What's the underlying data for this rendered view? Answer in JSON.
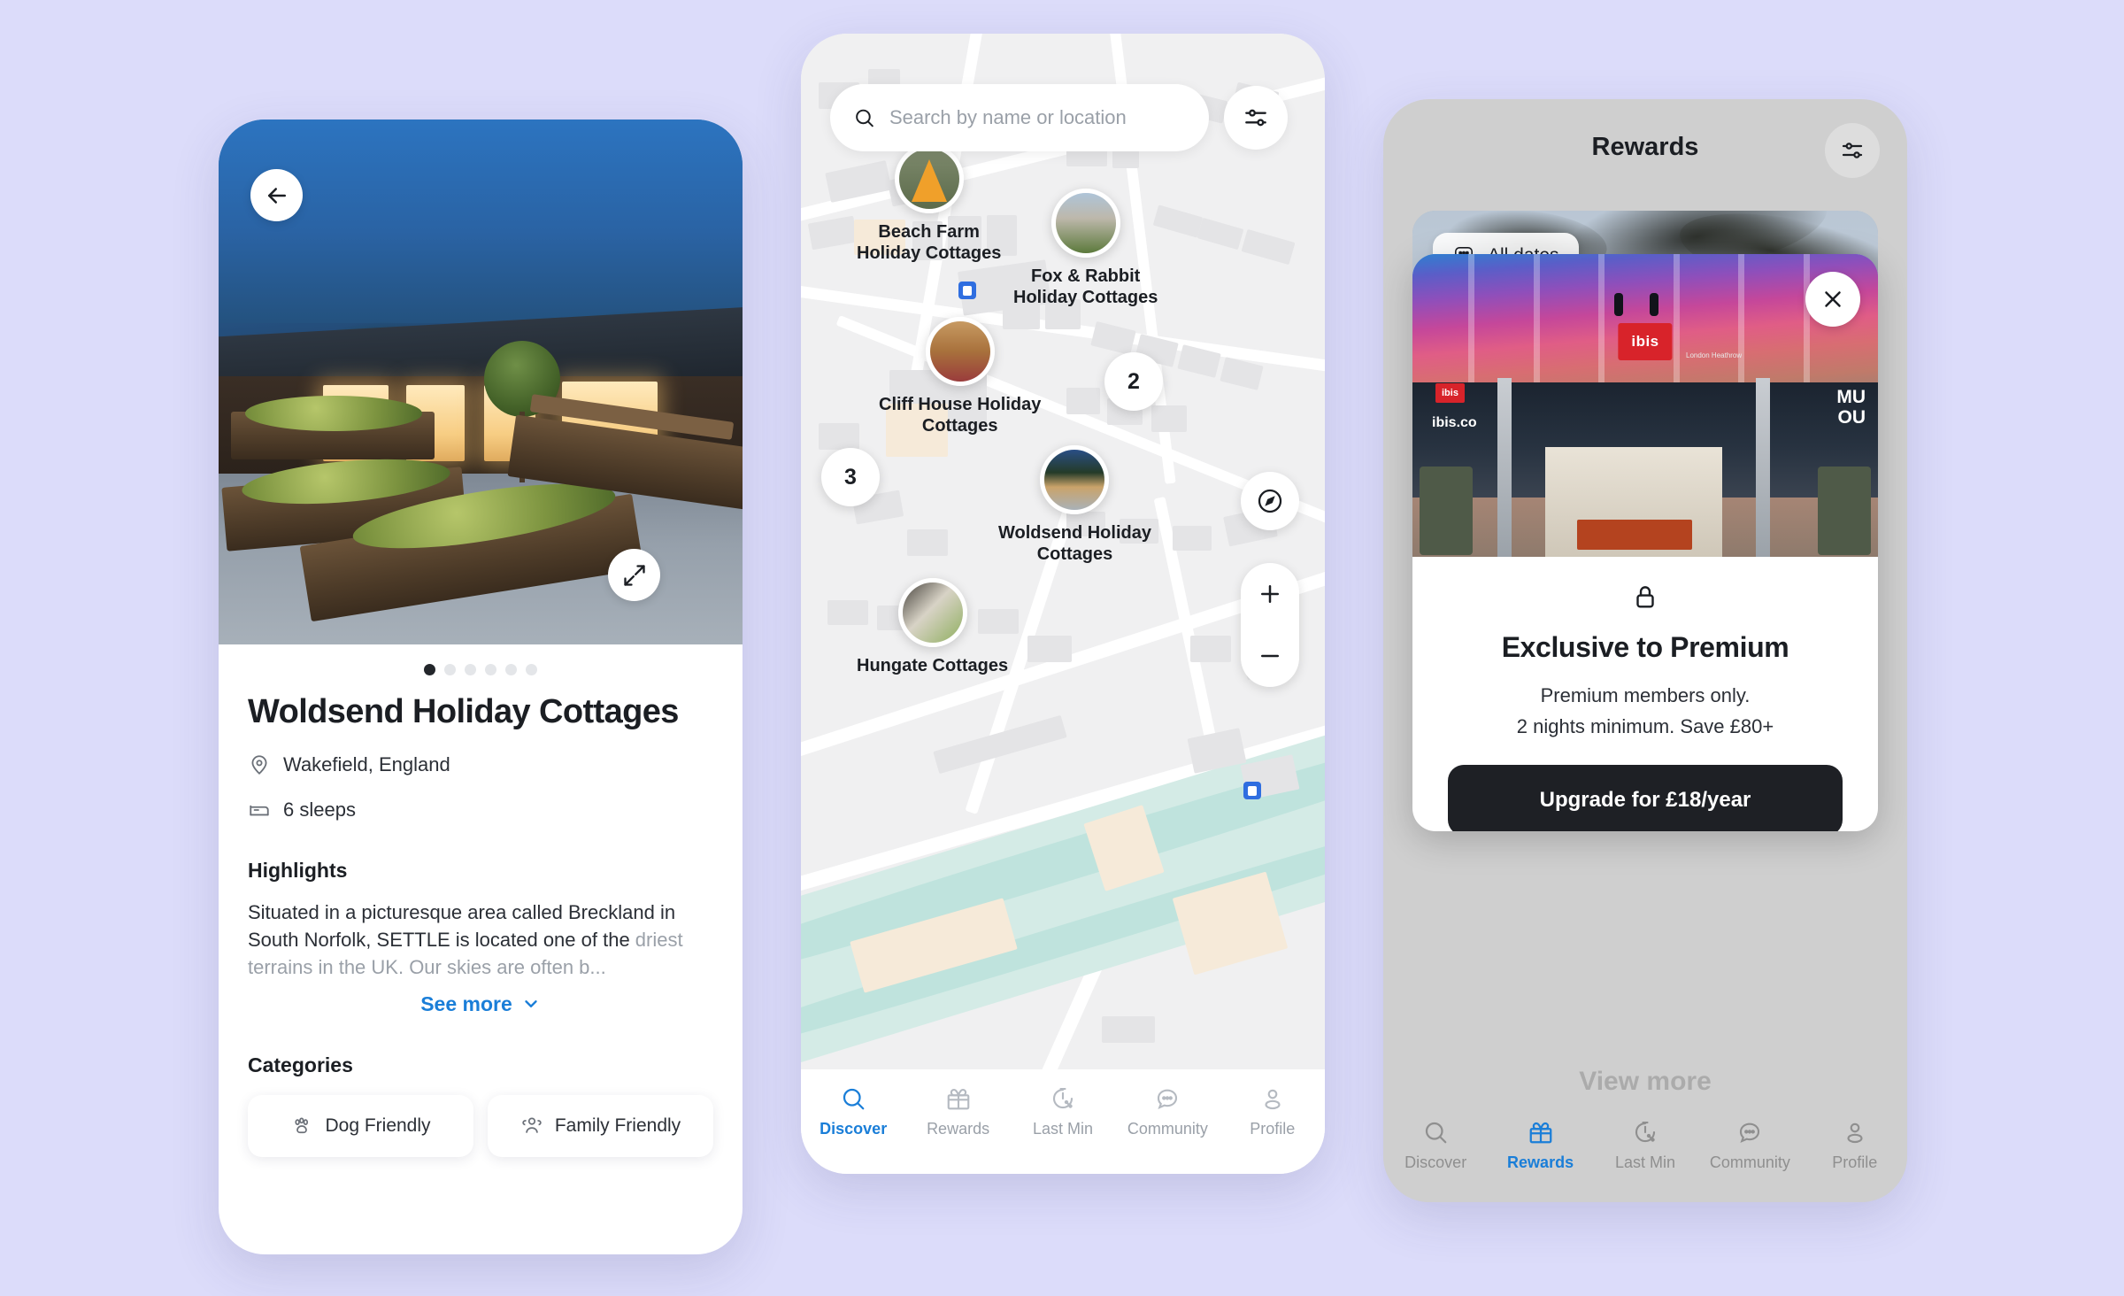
{
  "canvas": {
    "background": "#dcdcfa"
  },
  "accent": {
    "blue": "#1a7ed8",
    "dark": "#1e2025",
    "red": "#d8232a"
  },
  "listing_screen": {
    "back_icon": "arrow-left-icon",
    "expand_icon": "expand-arrows-icon",
    "gallery": {
      "total_dots": 6,
      "active_index": 0
    },
    "title": "Woldsend Holiday Cottages",
    "location_icon": "map-pin-icon",
    "location": "Wakefield, England",
    "sleeps_icon": "bed-icon",
    "sleeps": "6 sleeps",
    "highlights_heading": "Highlights",
    "highlights_text_visible": "Situated in a picturesque area called Breckland in South Norfolk, SETTLE is located one of the ",
    "highlights_text_faded": "driest terrains in the UK. Our skies are often b...",
    "see_more_label": "See more",
    "see_more_icon": "chevron-down-icon",
    "categories_heading": "Categories",
    "categories": [
      {
        "label": "Dog Friendly",
        "icon": "paw-icon"
      },
      {
        "label": "Family Friendly",
        "icon": "people-icon"
      }
    ]
  },
  "map_screen": {
    "search": {
      "placeholder": "Search by name or location",
      "value": "",
      "icon": "search-icon"
    },
    "filter_icon": "sliders-icon",
    "compass_icon": "compass-icon",
    "zoom_in_icon": "plus-icon",
    "zoom_out_icon": "minus-icon",
    "pins": [
      {
        "label_line1": "Beach Farm",
        "label_line2": "Holiday Cottages"
      },
      {
        "label_line1": "Fox & Rabbit",
        "label_line2": "Holiday Cottages"
      },
      {
        "label_line1": "Cliff House Holiday",
        "label_line2": "Cottages"
      },
      {
        "label_line1": "Woldsend Holiday",
        "label_line2": "Cottages"
      },
      {
        "label_line1": "Hungate Cottages",
        "label_line2": ""
      }
    ],
    "clusters": [
      "2",
      "3"
    ],
    "tabs": [
      {
        "label": "Discover",
        "icon": "search-icon",
        "active": true
      },
      {
        "label": "Rewards",
        "icon": "gift-icon",
        "active": false
      },
      {
        "label": "Last Min",
        "icon": "clock-percent-icon",
        "active": false
      },
      {
        "label": "Community",
        "icon": "chat-bubble-icon",
        "active": false
      },
      {
        "label": "Profile",
        "icon": "person-icon",
        "active": false
      }
    ]
  },
  "rewards_screen": {
    "title": "Rewards",
    "filter_icon": "sliders-icon",
    "date_chip": {
      "label": "All dates",
      "icon": "grid-dots-icon"
    },
    "modal": {
      "close_icon": "close-icon",
      "lock_icon": "lock-icon",
      "heading": "Exclusive to Premium",
      "line1": "Premium members only.",
      "line2": "2 nights minimum. Save £80+",
      "cta_label": "Upgrade for £18/year",
      "hotel_brand": "ibis",
      "hotel_brand_sub": "London Heathrow",
      "hotel_url": "ibis.co",
      "hotel_side_text": "MU\nOU"
    },
    "behind_text": "View more",
    "tabs": [
      {
        "label": "Discover",
        "icon": "search-icon",
        "active": false
      },
      {
        "label": "Rewards",
        "icon": "gift-icon",
        "active": true
      },
      {
        "label": "Last Min",
        "icon": "clock-percent-icon",
        "active": false
      },
      {
        "label": "Community",
        "icon": "chat-bubble-icon",
        "active": false
      },
      {
        "label": "Profile",
        "icon": "person-icon",
        "active": false
      }
    ]
  }
}
